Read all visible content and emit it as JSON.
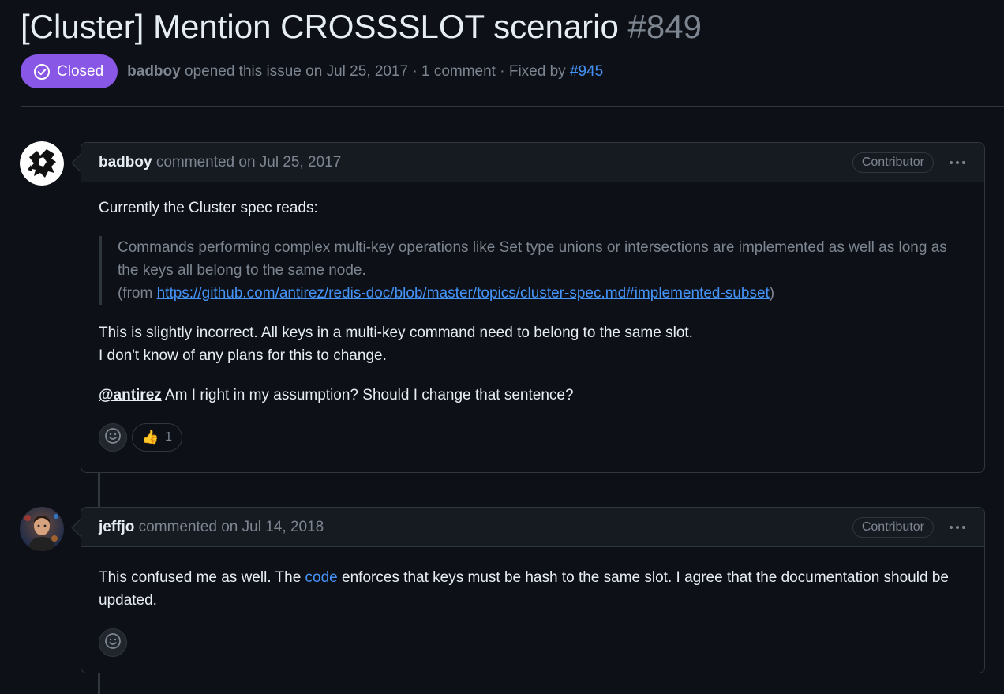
{
  "issue": {
    "title": "[Cluster] Mention CROSSSLOT scenario",
    "number": "#849",
    "state": "Closed",
    "author": "badboy",
    "opened_text": " opened this issue on Jul 25, 2017 · 1 comment · Fixed by ",
    "fixed_by": "#945"
  },
  "comments": [
    {
      "author": "badboy",
      "action": " commented on Jul 25, 2017",
      "role": "Contributor",
      "intro": "Currently the Cluster spec reads:",
      "quote_line": "Commands performing complex multi-key operations like Set type unions or intersections are implemented as well as long as the keys all belong to the same node.",
      "quote_from_prefix": "(from ",
      "quote_link": "https://github.com/antirez/redis-doc/blob/master/topics/cluster-spec.md#implemented-subset",
      "quote_from_suffix": ")",
      "para2_line1": "This is slightly incorrect. All keys in a multi-key command need to belong to the same slot.",
      "para2_line2": "I don't know of any plans for this to change.",
      "mention": "@antirez",
      "para3": " Am I right in my assumption? Should I change that sentence?",
      "reaction_emoji": "👍",
      "reaction_count": "1"
    },
    {
      "author": "jeffjo",
      "action": " commented on Jul 14, 2018",
      "role": "Contributor",
      "text_before": "This confused me as well. The ",
      "link_text": "code",
      "text_after": " enforces that keys must be hash to the same slot. I agree that the documentation should be updated."
    }
  ],
  "colors": {
    "background": "#0d1117",
    "closed_badge": "#8957e5",
    "link": "#4493f8",
    "border": "#30363d",
    "muted": "#7d8590"
  }
}
